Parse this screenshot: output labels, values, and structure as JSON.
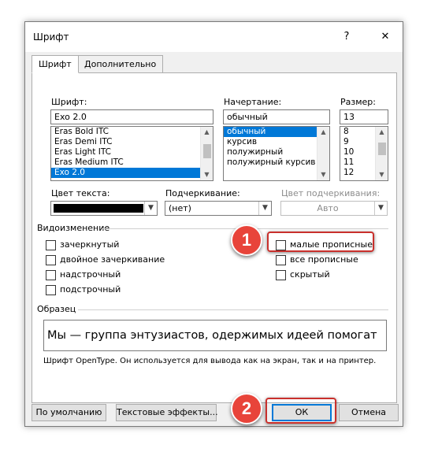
{
  "window": {
    "title": "Шрифт",
    "help_label": "?",
    "close_label": "✕"
  },
  "tabs": [
    {
      "label": "Шрифт",
      "active": true
    },
    {
      "label": "Дополнительно",
      "active": false
    }
  ],
  "font": {
    "label": "Шрифт:",
    "value": "Exo 2.0",
    "items": [
      "Eras Bold ITC",
      "Eras Demi ITC",
      "Eras Light ITC",
      "Eras Medium ITC",
      "Exo 2.0"
    ],
    "selected": "Exo 2.0"
  },
  "style": {
    "label": "Начертание:",
    "value": "обычный",
    "items": [
      "обычный",
      "курсив",
      "полужирный",
      "полужирный курсив"
    ],
    "selected": "обычный"
  },
  "size": {
    "label": "Размер:",
    "value": "13",
    "items": [
      "8",
      "9",
      "10",
      "11",
      "12"
    ],
    "selected": "12"
  },
  "text_color": {
    "label": "Цвет текста:",
    "color": "#000000"
  },
  "underline": {
    "label": "Подчеркивание:",
    "value": "(нет)"
  },
  "underline_color": {
    "label": "Цвет подчеркивания:",
    "value": "Авто"
  },
  "effects": {
    "label": "Видоизменение",
    "left": [
      {
        "label": "зачеркнутый",
        "checked": false
      },
      {
        "label": "двойное зачеркивание",
        "checked": false
      },
      {
        "label": "надстрочный",
        "checked": false
      },
      {
        "label": "подстрочный",
        "checked": false
      }
    ],
    "right": [
      {
        "label": "малые прописные",
        "checked": false
      },
      {
        "label": "все прописные",
        "checked": false
      },
      {
        "label": "скрытый",
        "checked": false
      }
    ]
  },
  "preview": {
    "label": "Образец",
    "text": "Мы — группа энтузиастов, одержимых идеей помогат",
    "description": "Шрифт OpenType. Он используется для вывода как на экран, так и на принтер."
  },
  "buttons": {
    "default_label": "По умолчанию",
    "text_effects_label": "Текстовые эффекты...",
    "ok_label": "ОК",
    "cancel_label": "Отмена"
  },
  "annotations": {
    "step1": "1",
    "step2": "2",
    "highlight_color": "#c9302c",
    "badge_color": "#e8443a"
  },
  "colors": {
    "selection": "#0078d7",
    "dialog_bg": "#f0f0f0"
  }
}
